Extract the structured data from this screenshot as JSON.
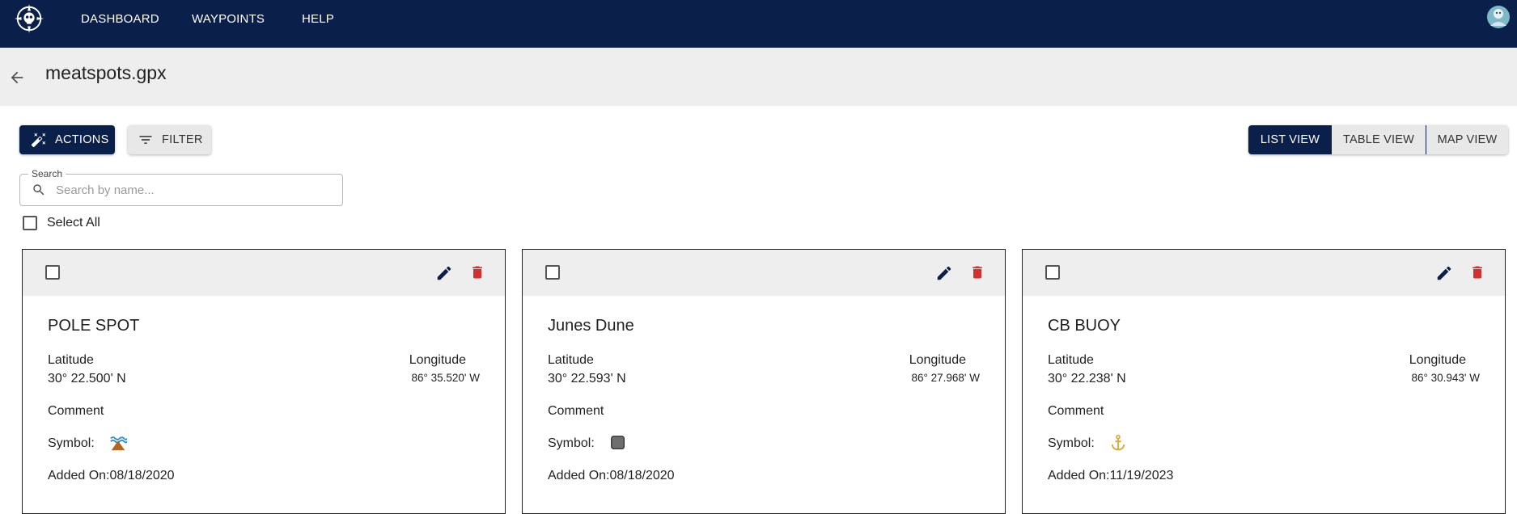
{
  "nav": {
    "items": [
      "DASHBOARD",
      "WAYPOINTS",
      "HELP"
    ]
  },
  "header": {
    "title": "meatspots.gpx"
  },
  "toolbar": {
    "actions_label": "ACTIONS",
    "filter_label": "FILTER",
    "views": [
      "LIST VIEW",
      "TABLE VIEW",
      "MAP VIEW"
    ],
    "active_view": "LIST VIEW"
  },
  "search": {
    "label": "Search",
    "placeholder": "Search by name..."
  },
  "select_all_label": "Select All",
  "card_labels": {
    "latitude": "Latitude",
    "longitude": "Longitude",
    "comment": "Comment",
    "symbol": "Symbol:",
    "added_on": "Added On:"
  },
  "waypoints": [
    {
      "name": "POLE SPOT",
      "latitude": "30° 22.500' N",
      "longitude": "86° 35.520' W",
      "symbol": "island-icon",
      "added_on": "08/18/2020"
    },
    {
      "name": "Junes Dune",
      "latitude": "30° 22.593' N",
      "longitude": "86° 27.968' W",
      "symbol": "gray-square-icon",
      "added_on": "08/18/2020"
    },
    {
      "name": "CB BUOY",
      "latitude": "30° 22.238' N",
      "longitude": "86° 30.943' W",
      "symbol": "anchor-icon",
      "added_on": "11/19/2023"
    }
  ],
  "colors": {
    "primary": "#0b1f4b",
    "delete": "#d32f2f",
    "anchor": "#d9a93a"
  }
}
